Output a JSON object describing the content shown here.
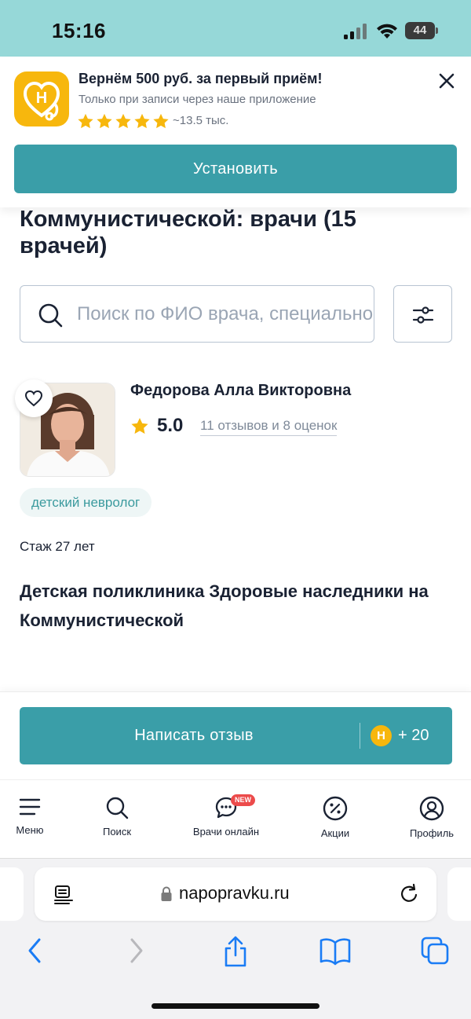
{
  "status_bar": {
    "time": "15:16",
    "battery": "44"
  },
  "banner": {
    "app_icon_letter": "Н",
    "title": "Вернём 500 руб. за первый приём!",
    "subtitle": "Только при записи через наше приложение",
    "rating_count": "~13.5 тыс.",
    "install_label": "Установить"
  },
  "page": {
    "title": "Коммунистической: врачи (15 врачей)",
    "search_placeholder": "Поиск по ФИО врача, специальности"
  },
  "doctor": {
    "name": "Федорова Алла Викторовна",
    "rating": "5.0",
    "reviews": "11 отзывов и 8 оценок",
    "specialty": "детский невролог",
    "experience": "Стаж 27 лет",
    "clinic": "Детская поликлиника Здоровые наследники на Коммунистической"
  },
  "review_bar": {
    "label": "Написать отзыв",
    "coin_letter": "Н",
    "bonus": "+ 20"
  },
  "nav": {
    "items": [
      {
        "label": "Меню"
      },
      {
        "label": "Поиск"
      },
      {
        "label": "Врачи онлайн",
        "badge": "NEW"
      },
      {
        "label": "Акции"
      },
      {
        "label": "Профиль"
      }
    ]
  },
  "browser": {
    "url": "napopravku.ru"
  },
  "colors": {
    "accent": "#3a9ea8",
    "status_bar": "#96d8d8",
    "star": "#f7b70d",
    "badge": "#ec4b4b"
  }
}
